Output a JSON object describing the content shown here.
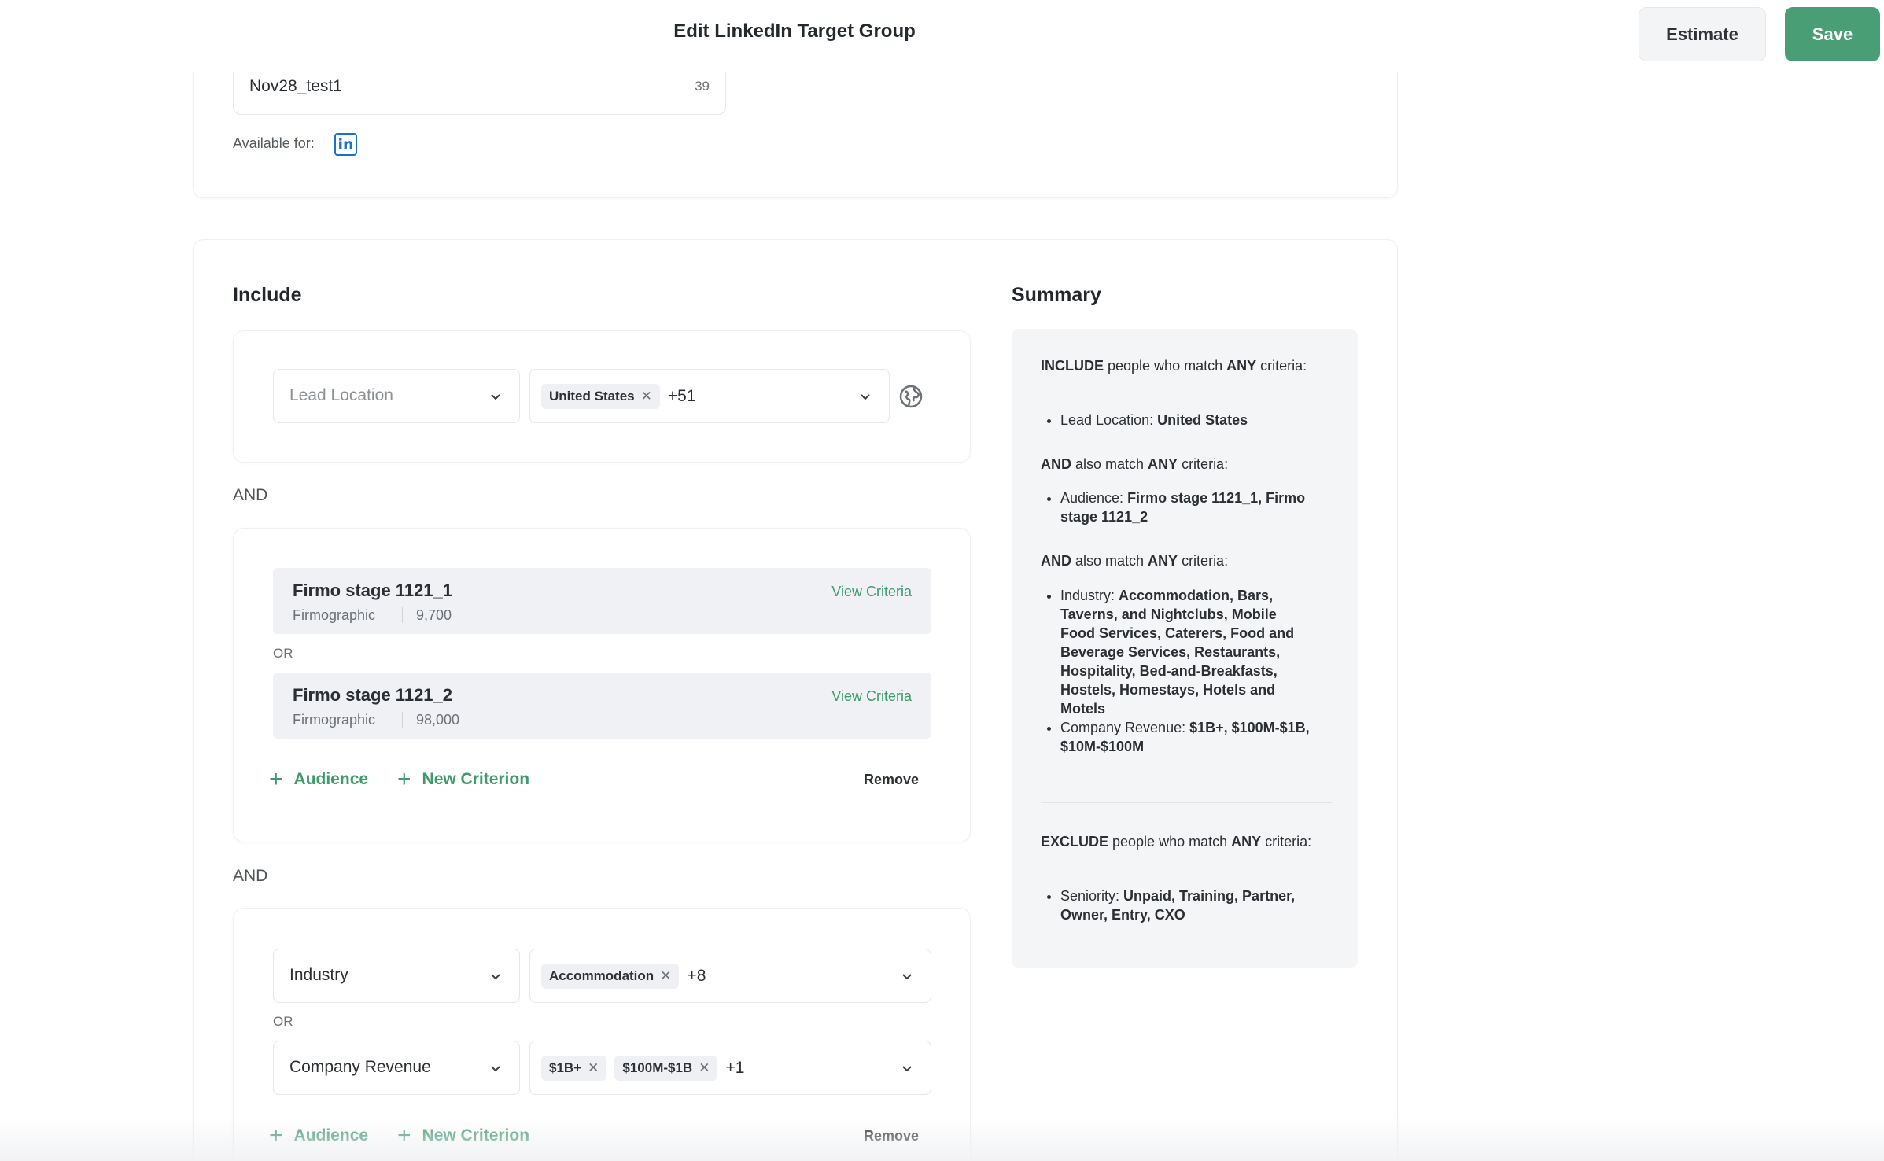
{
  "header": {
    "title": "Edit LinkedIn Target Group",
    "estimate_label": "Estimate",
    "save_label": "Save"
  },
  "details": {
    "name_value": "Nov28_test1",
    "name_char_count": "39",
    "available_for_label": "Available for:",
    "linkedin_icon": "in"
  },
  "include": {
    "title": "Include",
    "and_label": "AND",
    "or_label": "OR",
    "group1": {
      "field_placeholder": "Lead Location",
      "chips": [
        "United States"
      ],
      "more": "+51"
    },
    "group2": {
      "audiences": [
        {
          "name": "Firmo stage 1121_1",
          "type": "Firmographic",
          "count": "9,700",
          "view": "View Criteria"
        },
        {
          "name": "Firmo stage 1121_2",
          "type": "Firmographic",
          "count": "98,000",
          "view": "View Criteria"
        }
      ],
      "add_audience": "Audience",
      "add_criterion": "New Criterion",
      "remove": "Remove"
    },
    "group3": {
      "row1": {
        "field": "Industry",
        "chips": [
          "Accommodation"
        ],
        "more": "+8"
      },
      "row2": {
        "field": "Company Revenue",
        "chips": [
          "$1B+",
          "$100M-$1B"
        ],
        "more": "+1"
      },
      "add_audience": "Audience",
      "add_criterion": "New Criterion",
      "remove": "Remove"
    }
  },
  "summary": {
    "title": "Summary",
    "p1": {
      "a": "INCLUDE",
      "b": " people who match ",
      "c": "ANY",
      "d": " criteria:"
    },
    "b1": {
      "label": "Lead Location: ",
      "value": "United States"
    },
    "p2": {
      "a": "AND",
      "b": " also match ",
      "c": "ANY",
      "d": " criteria:"
    },
    "b2": {
      "label": "Audience: ",
      "value": "Firmo stage 1121_1, Firmo stage 1121_2"
    },
    "p3": {
      "a": "AND",
      "b": " also match ",
      "c": "ANY",
      "d": " criteria:"
    },
    "b3": {
      "label": "Industry: ",
      "value": "Accommodation, Bars, Taverns, and Nightclubs, Mobile Food Services, Caterers, Food and Beverage Services, Restaurants, Hospitality, Bed-and-Breakfasts, Hostels, Homestays, Hotels and Motels"
    },
    "b4": {
      "label": "Company Revenue: ",
      "value": "$1B+, $100M-$1B, $10M-$100M"
    },
    "p4": {
      "a": "EXCLUDE",
      "b": " people who match ",
      "c": "ANY",
      "d": " criteria:"
    },
    "b5": {
      "label": "Seniority: ",
      "value": "Unpaid, Training, Partner, Owner, Entry, CXO"
    }
  },
  "colors": {
    "accent": "#4a9e76",
    "link": "#3f9a6d",
    "linkedin": "#1a73c9"
  }
}
